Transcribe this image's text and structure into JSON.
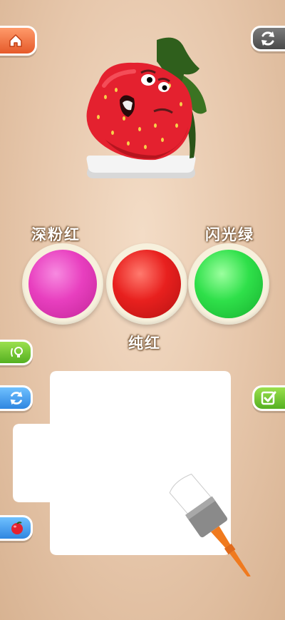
{
  "colors": [
    {
      "id": "pink",
      "label": "深粉红",
      "hex": "#e83fbf"
    },
    {
      "id": "red",
      "label": "纯红",
      "hex": "#e8201e"
    },
    {
      "id": "green",
      "label": "闪光绿",
      "hex": "#2fe04a"
    }
  ],
  "target_object": "strawberry",
  "icons": {
    "home": "home-icon",
    "restart_top": "refresh-icon",
    "hint": "lightbulb-icon",
    "reset": "refresh-icon",
    "confirm": "checkbox-check-icon",
    "fruit": "fruit-icon",
    "brush": "paint-brush-icon"
  },
  "theme": {
    "background": "#e6c6aa",
    "home_button": "#e55a2a",
    "restart_button": "#4a4a4a",
    "green_button": "#55b021",
    "blue_button": "#2f86e0",
    "canvas": "#ffffff"
  }
}
